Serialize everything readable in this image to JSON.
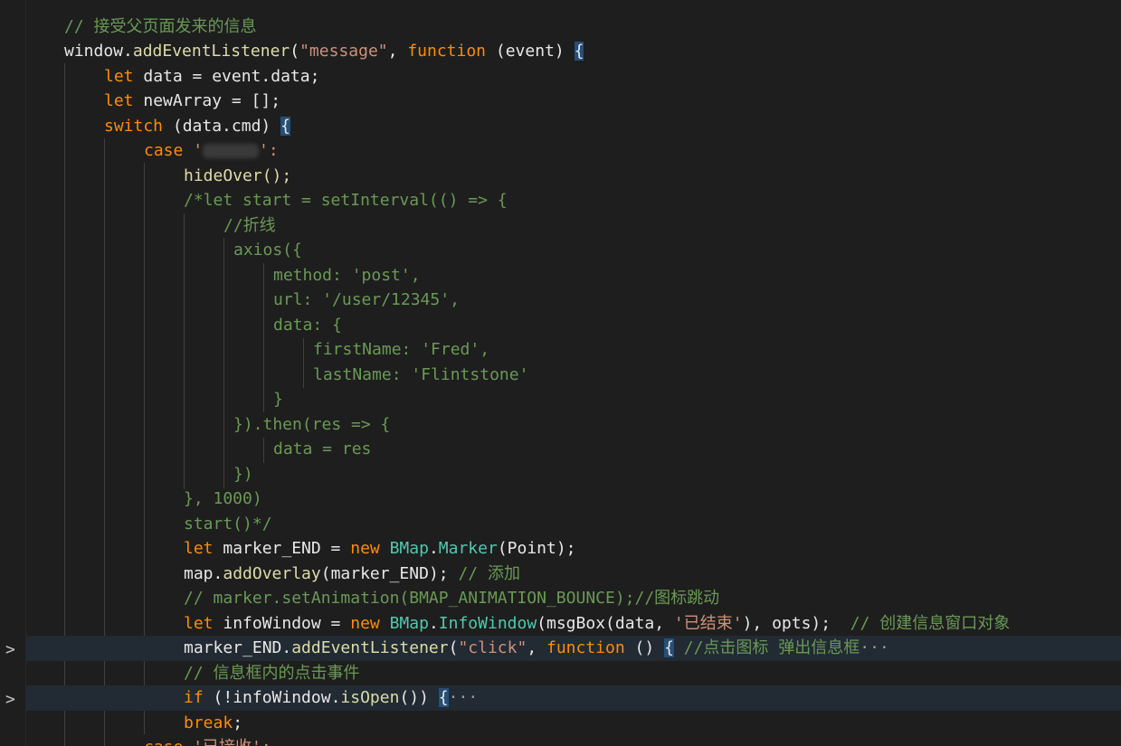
{
  "lines": {
    "l0": "// 接受父页面发来的信息",
    "l1_a": "window.",
    "l1_b": "addEventListener",
    "l1_c": "(",
    "l1_d": "\"message\"",
    "l1_e": ", ",
    "l1_f": "function",
    "l1_g": " (event) ",
    "l1_h": "{",
    "l2_a": "let",
    "l2_b": " data = event.data;",
    "l3_a": "let",
    "l3_b": " newArray = [];",
    "l4_a": "switch",
    "l4_b": " (data.cmd) ",
    "l4_c": "{",
    "l5_a": "case",
    "l5_b": " '",
    "l5_c": "':",
    "l6": "hideOver();",
    "l7": "/*let start = setInterval(() => {",
    "l8": "//折线",
    "l9": "axios({",
    "l10": "method: 'post',",
    "l11": "url: '/user/12345',",
    "l12": "data: {",
    "l13": "firstName: 'Fred',",
    "l14": "lastName: 'Flintstone'",
    "l15": "}",
    "l16": "}).then(res => {",
    "l17": "data = res",
    "l18": "})",
    "l19": "}, 1000)",
    "l20": "start()*/",
    "l21_a": "let",
    "l21_b": " marker_END = ",
    "l21_c": "new",
    "l21_d": " ",
    "l21_e": "BMap",
    "l21_f": ".",
    "l21_g": "Marker",
    "l21_h": "(Point);",
    "l22_a": "map.",
    "l22_b": "addOverlay",
    "l22_c": "(marker_END); ",
    "l22_d": "// 添加",
    "l23": "// marker.setAnimation(BMAP_ANIMATION_BOUNCE);//图标跳动",
    "l24_a": "let",
    "l24_b": " infoWindow = ",
    "l24_c": "new",
    "l24_d": " ",
    "l24_e": "BMap",
    "l24_f": ".",
    "l24_g": "InfoWindow",
    "l24_h": "(msgBox(data, ",
    "l24_i": "'已结束'",
    "l24_j": "), opts);  ",
    "l24_k": "// 创建信息窗口对象",
    "l25_a": "marker_END.",
    "l25_b": "addEventListener",
    "l25_c": "(",
    "l25_d": "\"click\"",
    "l25_e": ", ",
    "l25_f": "function",
    "l25_g": " () ",
    "l25_h": "{",
    "l25_i": " //点击图标 弹出信息框",
    "l25_j": "···",
    "l26": "// 信息框内的点击事件",
    "l27_a": "if",
    "l27_b": " (!infoWindow.",
    "l27_c": "isOpen",
    "l27_d": "()) ",
    "l27_e": "{",
    "l27_f": "···",
    "l28_a": "break",
    "l28_b": ";",
    "l29_a": "case",
    "l29_b": " '已接收':"
  },
  "fold_glyph": ">"
}
